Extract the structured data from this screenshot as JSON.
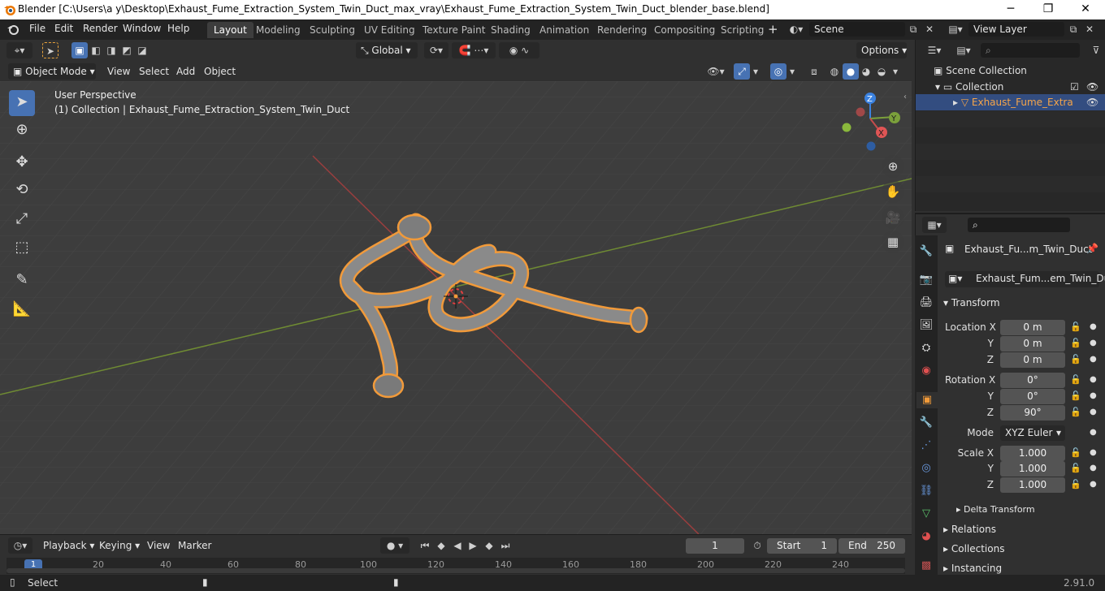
{
  "window": {
    "title": "Blender [C:\\Users\\a y\\Desktop\\Exhaust_Fume_Extraction_System_Twin_Duct_max_vray\\Exhaust_Fume_Extraction_System_Twin_Duct_blender_base.blend]",
    "minimize": "─",
    "maximize": "❐",
    "close": "✕"
  },
  "menu": [
    "File",
    "Edit",
    "Render",
    "Window",
    "Help"
  ],
  "workspaces": [
    "Layout",
    "Modeling",
    "Sculpting",
    "UV Editing",
    "Texture Paint",
    "Shading",
    "Animation",
    "Rendering",
    "Compositing",
    "Scripting"
  ],
  "active_workspace": "Layout",
  "scene": {
    "name": "Scene",
    "view_layer": "View Layer",
    "add_tab": "+"
  },
  "tool_header": {
    "orientation": "Global",
    "options": "Options"
  },
  "viewport_header": {
    "mode": "Object Mode",
    "menus": [
      "View",
      "Select",
      "Add",
      "Object"
    ]
  },
  "viewport": {
    "perspective": "User Perspective",
    "collection_line": "(1) Collection | Exhaust_Fume_Extraction_System_Twin_Duct",
    "gizmo": {
      "x": "X",
      "y": "Y",
      "z": "Z"
    }
  },
  "timeline": {
    "menus": [
      "Playback",
      "Keying",
      "View",
      "Marker"
    ],
    "current_frame": "1",
    "start_label": "Start",
    "start": "1",
    "end_label": "End",
    "end": "250",
    "ruler": [
      "1",
      "20",
      "40",
      "60",
      "80",
      "100",
      "120",
      "140",
      "160",
      "180",
      "200",
      "220",
      "240"
    ]
  },
  "status": {
    "left": "Select",
    "version": "2.91.0"
  },
  "outliner": {
    "scene_collection": "Scene Collection",
    "collection": "Collection",
    "object": "Exhaust_Fume_Extra"
  },
  "properties": {
    "object_name": "Exhaust_Fu...m_Twin_Duct",
    "data_name": "Exhaust_Fum...em_Twin_Duct",
    "transform": "Transform",
    "location_label": "Location X",
    "rotation_label": "Rotation X",
    "scale_label": "Scale X",
    "y_label": "Y",
    "z_label": "Z",
    "location": [
      "0 m",
      "0 m",
      "0 m"
    ],
    "rotation": [
      "0°",
      "0°",
      "90°"
    ],
    "mode_label": "Mode",
    "mode": "XYZ Euler",
    "scale": [
      "1.000",
      "1.000",
      "1.000"
    ],
    "delta": "Delta Transform",
    "relations": "Relations",
    "collections": "Collections",
    "instancing": "Instancing"
  },
  "colors": {
    "accent": "#4772b3",
    "selection": "#f19a3a",
    "axis_x": "#c54c4c",
    "axis_y": "#7ba03b",
    "axis_z": "#3b82e0"
  }
}
